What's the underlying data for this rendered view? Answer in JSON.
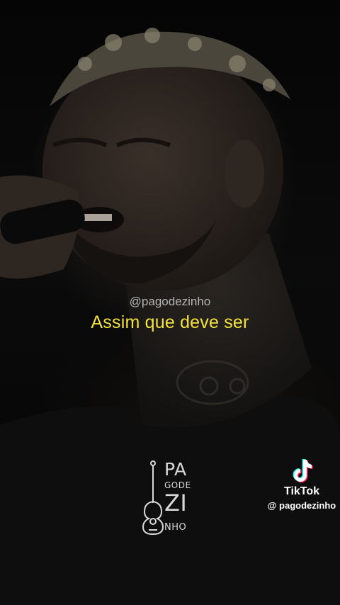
{
  "video": {
    "handle_overlay": "@pagodezinho",
    "lyric_caption": "Assim que deve ser"
  },
  "brand_logo": {
    "lines": [
      "PA",
      "GODE",
      "ZI",
      "NHO"
    ]
  },
  "watermark": {
    "brand": "TikTok",
    "username": "@ pagodezinho",
    "icon": "tiktok-note-icon"
  },
  "colors": {
    "caption": "#f2e23a",
    "handle": "#cfcfcf",
    "background": "#000000"
  }
}
